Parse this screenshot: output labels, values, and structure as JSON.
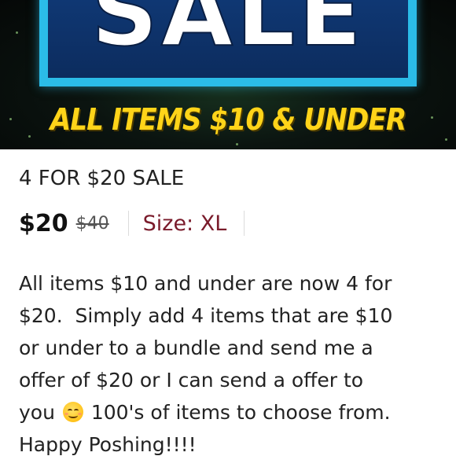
{
  "banner": {
    "headline": "SALE",
    "tagline": "ALL ITEMS $10 & UNDER",
    "colors": {
      "frame": "#2bbce8",
      "panel": "#103a78",
      "tagline": "#ffd419",
      "background": "#0b1410"
    }
  },
  "listing": {
    "title": "4 FOR $20 SALE",
    "price": "$20",
    "original_price": "$40",
    "size_label": "Size: XL",
    "description_lines": {
      "line1": "All items $10 and under are now 4 for",
      "line2": "$20.  Simply add 4 items that are $10",
      "line3": "or under to a bundle and send me a",
      "line4": "offer of $20 or I can send a offer to",
      "line5_before_emoji": "you",
      "emoji_icon": "smiling-face-icon",
      "line5_after_emoji": "100's of items to choose from.",
      "line6": "Happy Poshing!!!!"
    },
    "colors": {
      "size": "#7a1b2b",
      "text": "#222222"
    }
  }
}
